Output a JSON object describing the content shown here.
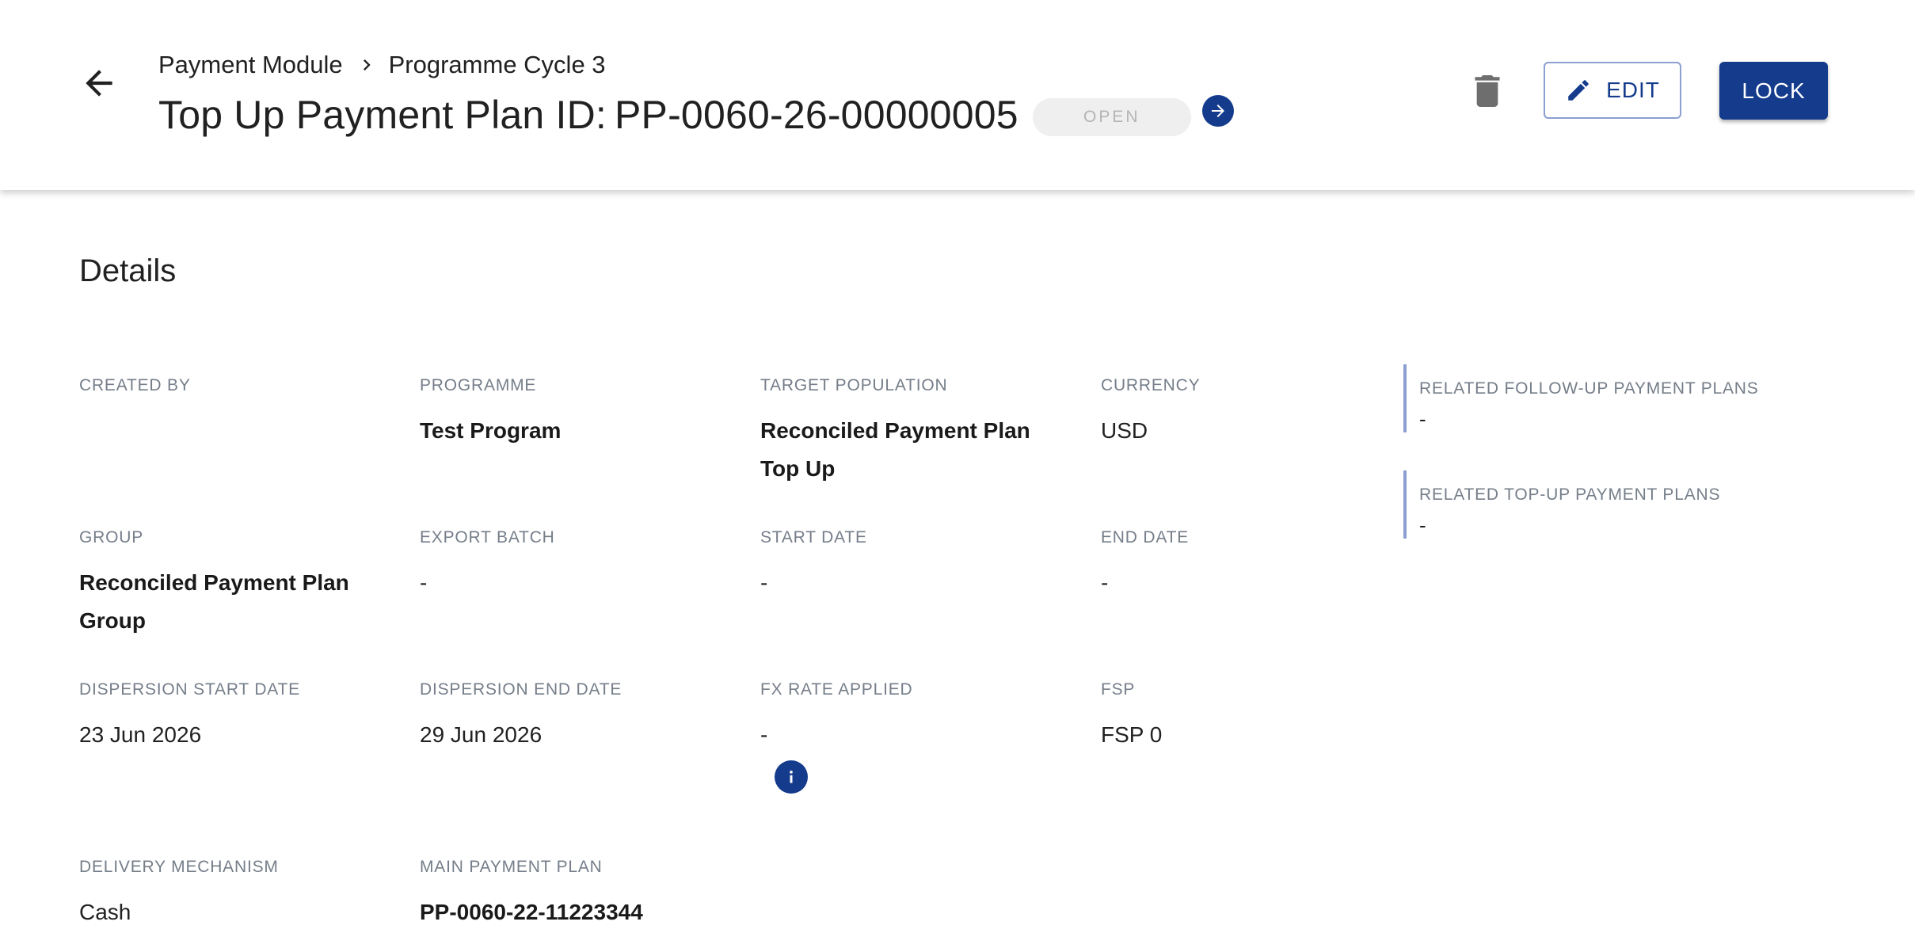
{
  "header": {
    "breadcrumb": [
      "Payment Module",
      "Programme Cycle 3"
    ],
    "title_prefix": "Top Up Payment Plan ID:",
    "plan_id": "PP-0060-26-00000005",
    "status": "OPEN",
    "edit_label": "EDIT",
    "lock_label": "LOCK"
  },
  "details": {
    "section_title": "Details",
    "created_by": {
      "label": "CREATED BY",
      "value": ""
    },
    "programme": {
      "label": "PROGRAMME",
      "value": "Test Program"
    },
    "target_population": {
      "label": "TARGET POPULATION",
      "value": "Reconciled Payment Plan Top Up"
    },
    "currency": {
      "label": "CURRENCY",
      "value": "USD"
    },
    "group": {
      "label": "GROUP",
      "value": "Reconciled Payment Plan Group"
    },
    "export_batch": {
      "label": "EXPORT BATCH",
      "value": "-"
    },
    "start_date": {
      "label": "START DATE",
      "value": "-"
    },
    "end_date": {
      "label": "END DATE",
      "value": "-"
    },
    "dispersion_start_date": {
      "label": "DISPERSION START DATE",
      "value": "23 Jun 2026"
    },
    "dispersion_end_date": {
      "label": "DISPERSION END DATE",
      "value": "29 Jun 2026"
    },
    "fx_rate_applied": {
      "label": "FX RATE APPLIED",
      "value": "-"
    },
    "fsp": {
      "label": "FSP",
      "value": "FSP 0"
    },
    "delivery_mechanism": {
      "label": "DELIVERY MECHANISM",
      "value": "Cash"
    },
    "main_payment_plan": {
      "label": "MAIN PAYMENT PLAN",
      "value": "PP-0060-22-11223344"
    }
  },
  "related": {
    "follow_up": {
      "label": "RELATED FOLLOW-UP PAYMENT PLANS",
      "value": "-"
    },
    "top_up": {
      "label": "RELATED TOP-UP PAYMENT PLANS",
      "value": "-"
    }
  },
  "colors": {
    "primary": "#143b8c",
    "outline": "#8b9fd0",
    "label": "#757e89",
    "badge_bg": "#efefef"
  },
  "icons": {
    "back": "arrow-left-icon",
    "breadcrumb_separator": "chevron-right-icon",
    "goto": "arrow-right-circle-icon",
    "delete": "trash-icon",
    "edit": "pencil-icon",
    "info": "info-icon"
  }
}
